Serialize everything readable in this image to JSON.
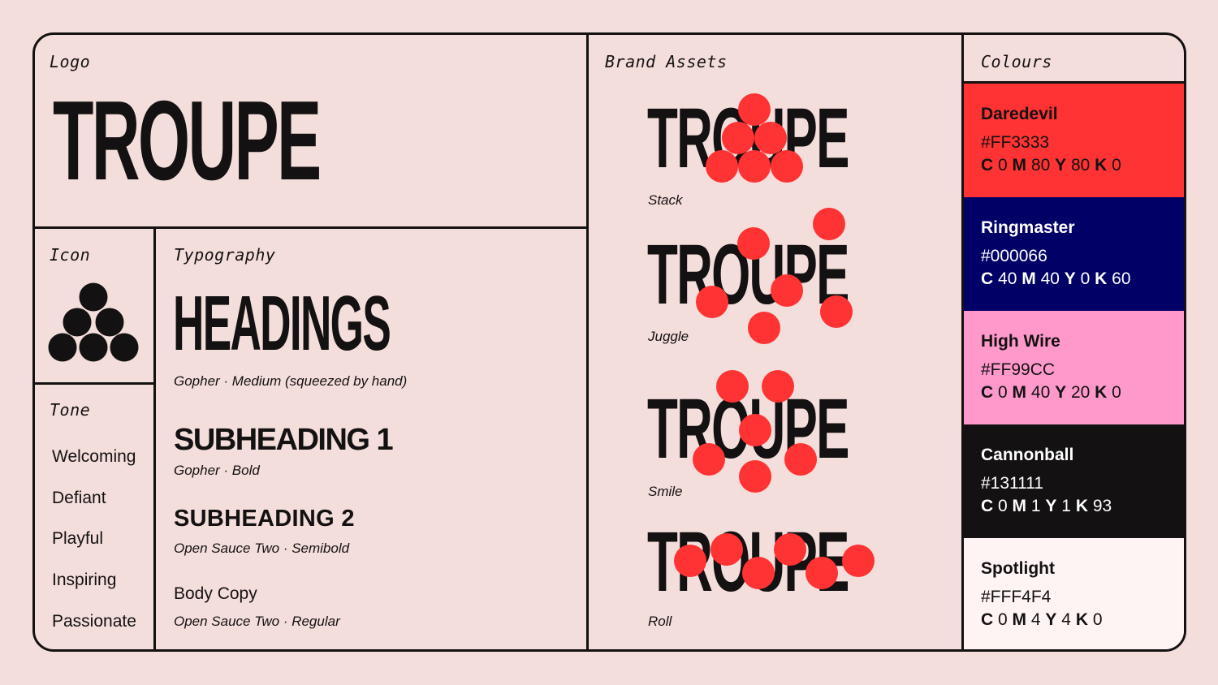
{
  "logo": {
    "label": "Logo",
    "wordmark": "TROUPE"
  },
  "icon": {
    "label": "Icon"
  },
  "tone": {
    "label": "Tone",
    "items": [
      "Welcoming",
      "Defiant",
      "Playful",
      "Inspiring",
      "Passionate"
    ]
  },
  "typography": {
    "label": "Typography",
    "heading": "HEADINGS",
    "heading_caption": "Gopher · Medium (squeezed by hand)",
    "sub1": "SUBHEADING 1",
    "sub1_caption": "Gopher · Bold",
    "sub2": "SUBHEADING 2",
    "sub2_caption": "Open Sauce Two · Semibold",
    "body": "Body Copy",
    "body_caption": "Open Sauce Two · Regular"
  },
  "brand_assets": {
    "label": "Brand Assets",
    "wordmark": "TROUPE",
    "variants": [
      "Stack",
      "Juggle",
      "Smile",
      "Roll"
    ]
  },
  "colours": {
    "label": "Colours",
    "accent": "#FF3333",
    "swatches": [
      {
        "name": "Daredevil",
        "hex": "#FF3333",
        "c": "0",
        "m": "80",
        "y": "80",
        "k": "0",
        "bg": "#FF3333",
        "fg": "#131111"
      },
      {
        "name": "Ringmaster",
        "hex": "#000066",
        "c": "40",
        "m": "40",
        "y": "0",
        "k": "60",
        "bg": "#000066",
        "fg": "#FFFFFF"
      },
      {
        "name": "High Wire",
        "hex": "#FF99CC",
        "c": "0",
        "m": "40",
        "y": "20",
        "k": "0",
        "bg": "#FF99CC",
        "fg": "#131111"
      },
      {
        "name": "Cannonball",
        "hex": "#131111",
        "c": "0",
        "m": "1",
        "y": "1",
        "k": "93",
        "bg": "#131111",
        "fg": "#FFFFFF"
      },
      {
        "name": "Spotlight",
        "hex": "#FFF4F4",
        "c": "0",
        "m": "4",
        "y": "4",
        "k": "0",
        "bg": "#FFF4F4",
        "fg": "#131111"
      }
    ]
  }
}
